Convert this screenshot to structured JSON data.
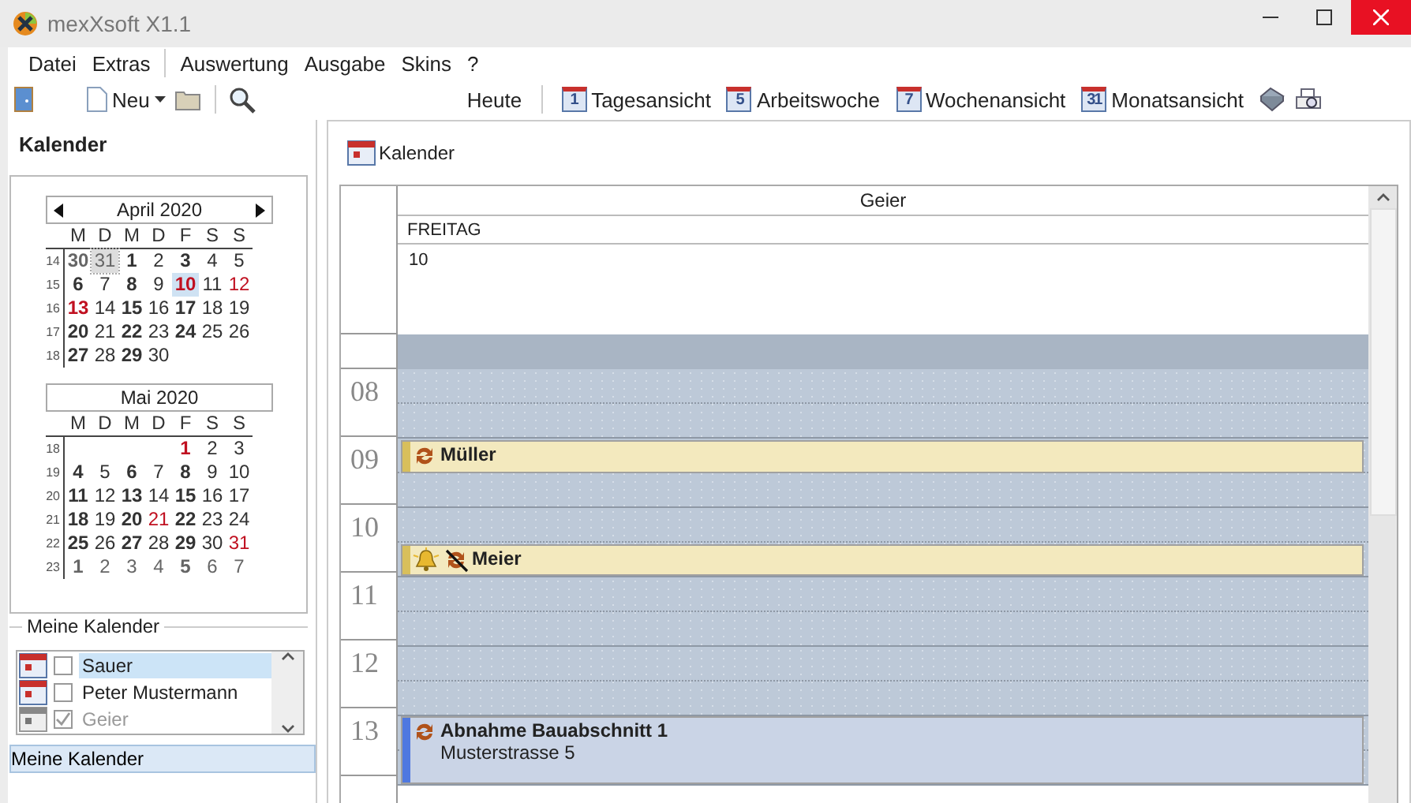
{
  "window": {
    "title": "mexXsoft X1.1"
  },
  "menu": [
    "Datei",
    "Extras",
    "Auswertung",
    "Ausgabe",
    "Skins",
    "?"
  ],
  "toolbar": {
    "new_label": "Neu",
    "today_label": "Heute",
    "views": [
      {
        "label": "Tagesansicht",
        "icon_number": "1"
      },
      {
        "label": "Arbeitswoche",
        "icon_number": "5"
      },
      {
        "label": "Wochenansicht",
        "icon_number": "7"
      },
      {
        "label": "Monatsansicht",
        "icon_number": "31"
      }
    ]
  },
  "sidebar": {
    "title": "Kalender",
    "months": [
      {
        "title": "April 2020",
        "navigation": true,
        "weekdays": [
          "M",
          "D",
          "M",
          "D",
          "F",
          "S",
          "S"
        ],
        "weeks": [
          {
            "number": "14",
            "days": [
              {
                "text": "30",
                "kind": "other-bold",
                "selected": false
              },
              {
                "text": "31",
                "kind": "other-marked",
                "selected": false
              },
              {
                "text": "1",
                "kind": "bold",
                "selected": false
              },
              {
                "text": "2",
                "kind": "plain",
                "selected": false
              },
              {
                "text": "3",
                "kind": "bold",
                "selected": false
              },
              {
                "text": "4",
                "kind": "plain",
                "selected": false
              },
              {
                "text": "5",
                "kind": "plain",
                "selected": false
              }
            ]
          },
          {
            "number": "15",
            "days": [
              {
                "text": "6",
                "kind": "bold",
                "selected": false
              },
              {
                "text": "7",
                "kind": "plain",
                "selected": false
              },
              {
                "text": "8",
                "kind": "bold",
                "selected": false
              },
              {
                "text": "9",
                "kind": "plain",
                "selected": false
              },
              {
                "text": "10",
                "kind": "holiday-bold",
                "selected": true
              },
              {
                "text": "11",
                "kind": "plain",
                "selected": false
              },
              {
                "text": "12",
                "kind": "holiday",
                "selected": false
              }
            ]
          },
          {
            "number": "16",
            "days": [
              {
                "text": "13",
                "kind": "holiday-bold",
                "selected": false
              },
              {
                "text": "14",
                "kind": "plain",
                "selected": false
              },
              {
                "text": "15",
                "kind": "bold",
                "selected": false
              },
              {
                "text": "16",
                "kind": "plain",
                "selected": false
              },
              {
                "text": "17",
                "kind": "bold",
                "selected": false
              },
              {
                "text": "18",
                "kind": "plain",
                "selected": false
              },
              {
                "text": "19",
                "kind": "plain",
                "selected": false
              }
            ]
          },
          {
            "number": "17",
            "days": [
              {
                "text": "20",
                "kind": "bold",
                "selected": false
              },
              {
                "text": "21",
                "kind": "plain",
                "selected": false
              },
              {
                "text": "22",
                "kind": "bold",
                "selected": false
              },
              {
                "text": "23",
                "kind": "plain",
                "selected": false
              },
              {
                "text": "24",
                "kind": "bold",
                "selected": false
              },
              {
                "text": "25",
                "kind": "plain",
                "selected": false
              },
              {
                "text": "26",
                "kind": "plain",
                "selected": false
              }
            ]
          },
          {
            "number": "18",
            "days": [
              {
                "text": "27",
                "kind": "bold",
                "selected": false
              },
              {
                "text": "28",
                "kind": "plain",
                "selected": false
              },
              {
                "text": "29",
                "kind": "bold",
                "selected": false
              },
              {
                "text": "30",
                "kind": "plain",
                "selected": false
              }
            ]
          }
        ]
      },
      {
        "title": "Mai 2020",
        "navigation": false,
        "weekdays": [
          "M",
          "D",
          "M",
          "D",
          "F",
          "S",
          "S"
        ],
        "weeks": [
          {
            "number": "18",
            "days": [
              {
                "text": "1",
                "kind": "holiday-bold",
                "selected": false
              },
              {
                "text": "2",
                "kind": "plain",
                "selected": false
              },
              {
                "text": "3",
                "kind": "plain",
                "selected": false
              }
            ]
          },
          {
            "number": "19",
            "days": [
              {
                "text": "4",
                "kind": "bold",
                "selected": false
              },
              {
                "text": "5",
                "kind": "plain",
                "selected": false
              },
              {
                "text": "6",
                "kind": "bold",
                "selected": false
              },
              {
                "text": "7",
                "kind": "plain",
                "selected": false
              },
              {
                "text": "8",
                "kind": "bold",
                "selected": false
              },
              {
                "text": "9",
                "kind": "plain",
                "selected": false
              },
              {
                "text": "10",
                "kind": "plain",
                "selected": false
              }
            ]
          },
          {
            "number": "20",
            "days": [
              {
                "text": "11",
                "kind": "bold",
                "selected": false
              },
              {
                "text": "12",
                "kind": "plain",
                "selected": false
              },
              {
                "text": "13",
                "kind": "bold",
                "selected": false
              },
              {
                "text": "14",
                "kind": "plain",
                "selected": false
              },
              {
                "text": "15",
                "kind": "bold",
                "selected": false
              },
              {
                "text": "16",
                "kind": "plain",
                "selected": false
              },
              {
                "text": "17",
                "kind": "plain",
                "selected": false
              }
            ]
          },
          {
            "number": "21",
            "days": [
              {
                "text": "18",
                "kind": "bold",
                "selected": false
              },
              {
                "text": "19",
                "kind": "plain",
                "selected": false
              },
              {
                "text": "20",
                "kind": "bold",
                "selected": false
              },
              {
                "text": "21",
                "kind": "holiday",
                "selected": false
              },
              {
                "text": "22",
                "kind": "bold",
                "selected": false
              },
              {
                "text": "23",
                "kind": "plain",
                "selected": false
              },
              {
                "text": "24",
                "kind": "plain",
                "selected": false
              }
            ]
          },
          {
            "number": "22",
            "days": [
              {
                "text": "25",
                "kind": "bold",
                "selected": false
              },
              {
                "text": "26",
                "kind": "plain",
                "selected": false
              },
              {
                "text": "27",
                "kind": "bold",
                "selected": false
              },
              {
                "text": "28",
                "kind": "plain",
                "selected": false
              },
              {
                "text": "29",
                "kind": "bold",
                "selected": false
              },
              {
                "text": "30",
                "kind": "plain",
                "selected": false
              },
              {
                "text": "31",
                "kind": "holiday",
                "selected": false
              }
            ]
          },
          {
            "number": "23",
            "days": [
              {
                "text": "1",
                "kind": "other-holiday-bold",
                "selected": false
              },
              {
                "text": "2",
                "kind": "other",
                "selected": false
              },
              {
                "text": "3",
                "kind": "other",
                "selected": false
              },
              {
                "text": "4",
                "kind": "other",
                "selected": false
              },
              {
                "text": "5",
                "kind": "other-bold",
                "selected": false
              },
              {
                "text": "6",
                "kind": "other",
                "selected": false
              },
              {
                "text": "7",
                "kind": "other",
                "selected": false
              }
            ]
          }
        ]
      }
    ],
    "calendars": {
      "title": "Meine Kalender",
      "items": [
        {
          "name": "Sauer",
          "checked": false,
          "selected": true,
          "disabled": false
        },
        {
          "name": "Peter Mustermann",
          "checked": false,
          "selected": false,
          "disabled": false
        },
        {
          "name": "Geier",
          "checked": true,
          "selected": false,
          "disabled": true
        }
      ]
    },
    "footer_button": "Meine Kalender"
  },
  "main": {
    "title": "Kalender",
    "resource": "Geier",
    "weekday": "FREITAG",
    "day": "10",
    "hours": [
      {
        "label": "08"
      },
      {
        "label": "09",
        "appointments": [
          {
            "kind": "early",
            "title": "Müller",
            "color": "#d8bf5c",
            "reminder": false,
            "recurring": true,
            "exception": false
          }
        ]
      },
      {
        "label": "10",
        "appointments": [
          {
            "kind": "late",
            "title": "Meier",
            "color": "#d8bf5c",
            "reminder": true,
            "recurring": true,
            "exception": true
          }
        ]
      },
      {
        "label": "11"
      },
      {
        "label": "12"
      },
      {
        "label": "13",
        "appointments": [
          {
            "kind": "full",
            "title": "Abnahme Bauabschnitt 1",
            "location": "Musterstrasse 5",
            "color": "#4f78e0",
            "reminder": false,
            "recurring": true,
            "exception": false
          }
        ]
      }
    ]
  }
}
